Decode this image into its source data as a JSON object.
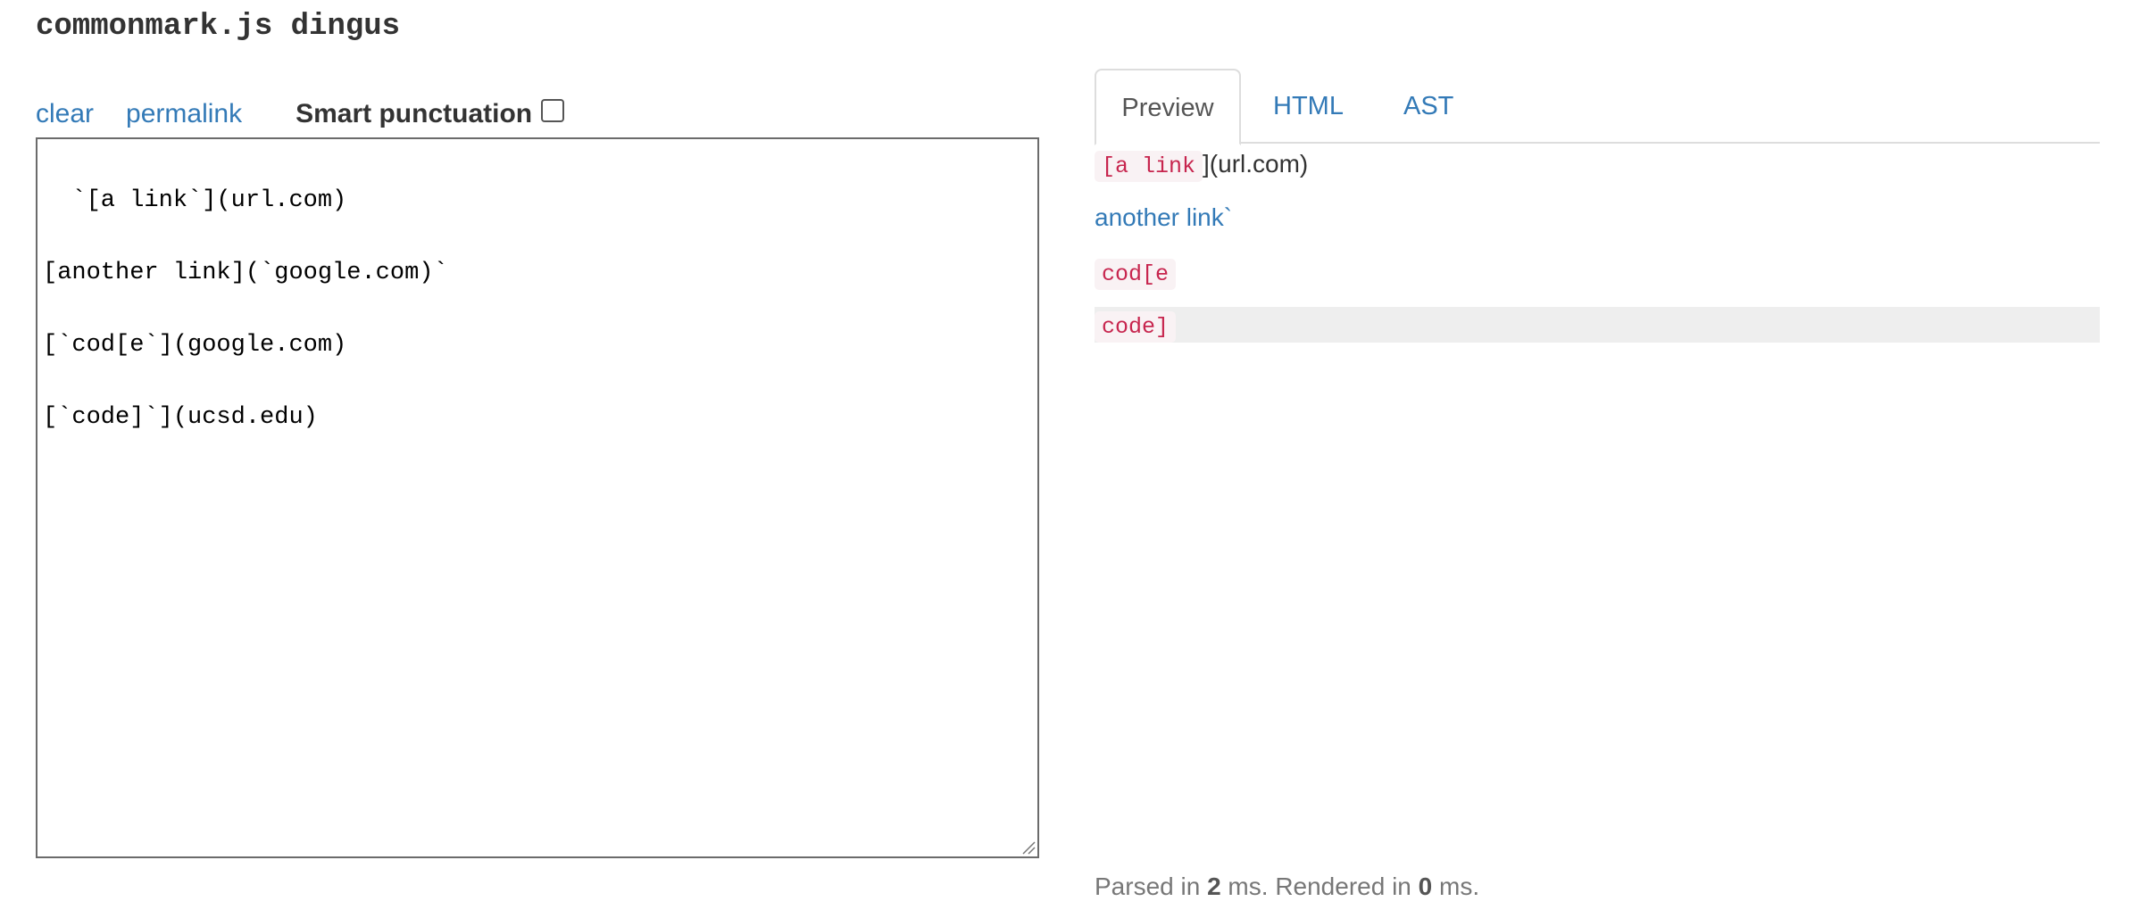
{
  "page": {
    "title": "commonmark.js dingus"
  },
  "toolbar": {
    "clear_label": "clear",
    "permalink_label": "permalink",
    "smart_punctuation_label": "Smart punctuation",
    "smart_punctuation_checked": false
  },
  "editor": {
    "content": "`[a link`](url.com)\n\n[another link](`google.com)`\n\n[`cod[e`](google.com)\n\n[`code]`](ucsd.edu)"
  },
  "tabs": [
    {
      "label": "Preview",
      "active": true
    },
    {
      "label": "HTML",
      "active": false
    },
    {
      "label": "AST",
      "active": false
    }
  ],
  "preview": {
    "p1_code": "[a link",
    "p1_text": "](url.com)",
    "p2_link": "another link`",
    "p3_code": "cod[e",
    "p4_code": "code]"
  },
  "status": {
    "parsed_prefix": "Parsed in ",
    "parsed_ms": "2",
    "rendered_prefix": " ms. Rendered in ",
    "rendered_ms": "0",
    "suffix": " ms."
  },
  "colors": {
    "link": "#337ab7",
    "code_text": "#c7254e",
    "code_bg": "#f9f2f4",
    "highlight_row": "#eeeeee"
  }
}
